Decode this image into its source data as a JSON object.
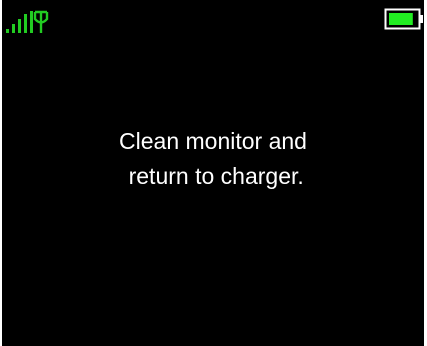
{
  "status_bar": {
    "signal_icon": "signal-antenna-icon",
    "battery_icon": "battery-icon",
    "signal_color": "#22cc22",
    "battery_color": "#22ee22",
    "battery_level": 0.85
  },
  "message": {
    "line1": "Clean monitor and",
    "line2": " return to charger."
  },
  "colors": {
    "background": "#000000",
    "text": "#ffffff"
  }
}
